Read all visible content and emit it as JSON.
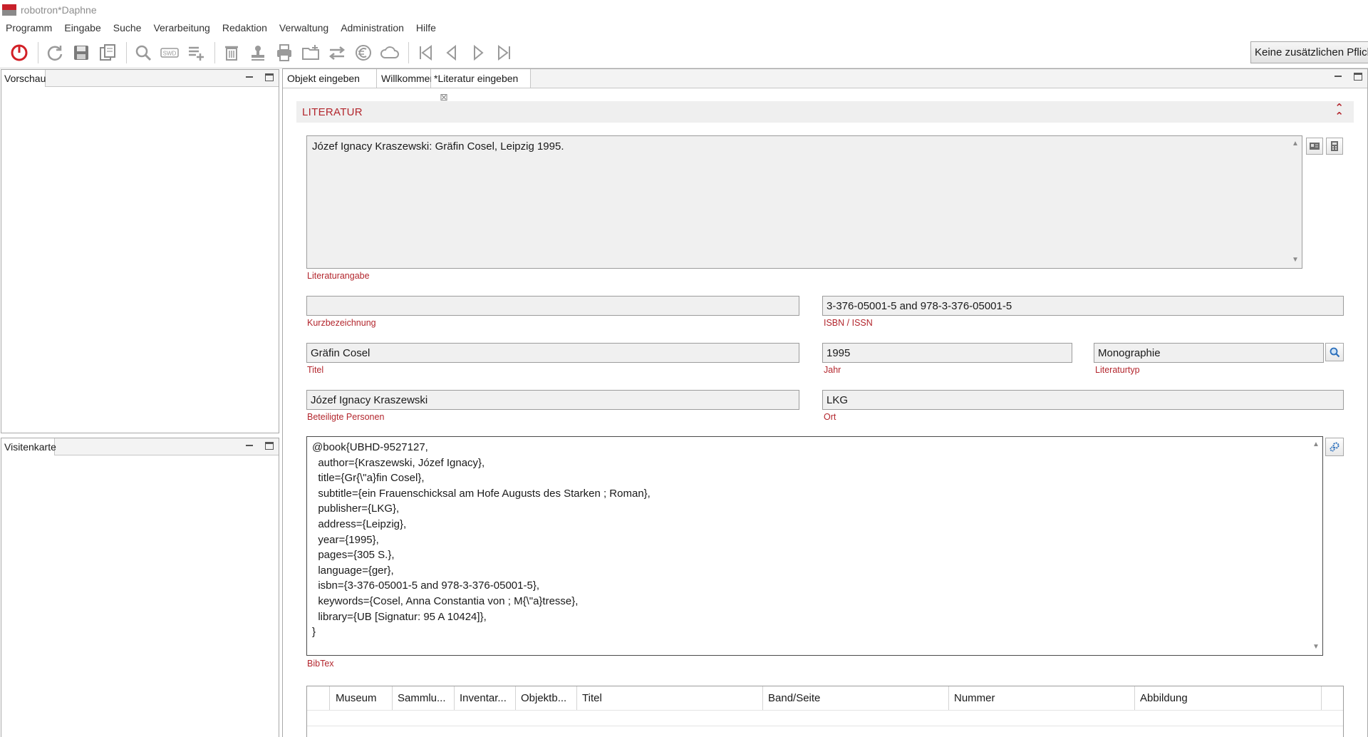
{
  "window": {
    "title": "robotron*Daphne"
  },
  "menubar": [
    "Programm",
    "Eingabe",
    "Suche",
    "Verarbeitung",
    "Redaktion",
    "Verwaltung",
    "Administration",
    "Hilfe"
  ],
  "toolbar": {
    "icons": [
      "power-icon",
      "refresh-icon",
      "save-icon",
      "copy-icon",
      "search-icon",
      "swd-icon",
      "add-list-icon",
      "delete-icon",
      "stamp-icon",
      "print-icon",
      "folder-add-icon",
      "transfer-icon",
      "euro-icon",
      "cloud-icon",
      "first-record-icon",
      "previous-record-icon",
      "next-record-icon",
      "last-record-icon"
    ],
    "swd_text": "SWD",
    "required_fields_button": "Keine zusätzlichen Pflichtfelder"
  },
  "panels": {
    "preview": {
      "tab": "Vorschau"
    },
    "card": {
      "tab": "Visitenkarte"
    }
  },
  "editor_tabs": [
    {
      "label": "Objekt eingeben"
    },
    {
      "label": "Willkommen"
    },
    {
      "label": "*Literatur eingeben"
    }
  ],
  "section": {
    "title": "LITERATUR",
    "collapse_symbol": "⌃"
  },
  "form": {
    "literaturangabe": {
      "value": "Józef Ignacy Kraszewski: Gräfin Cosel, Leipzig 1995.",
      "label": "Literaturangabe"
    },
    "kurzbezeichnung": {
      "value": "",
      "label": "Kurzbezeichnung"
    },
    "isbn": {
      "value": "3-376-05001-5 and 978-3-376-05001-5",
      "label": "ISBN / ISSN"
    },
    "titel": {
      "value": "Gräfin Cosel",
      "label": "Titel"
    },
    "jahr": {
      "value": "1995",
      "label": "Jahr"
    },
    "literaturtyp": {
      "value": "Monographie",
      "label": "Literaturtyp"
    },
    "personen": {
      "value": "Józef Ignacy Kraszewski",
      "label": "Beteiligte Personen"
    },
    "ort": {
      "value": "LKG",
      "label": "Ort"
    },
    "bibtex": {
      "label": "BibTex",
      "lines": [
        "@book{UBHD-9527127,",
        "  author={Kraszewski, Józef Ignacy},",
        "  title={Gr{\\\"a}fin Cosel},",
        "  subtitle={ein Frauenschicksal am Hofe Augusts des Starken ; Roman},",
        "  publisher={LKG},",
        "  address={Leipzig},",
        "  year={1995},",
        "  pages={305 S.},",
        "  language={ger},",
        "  isbn={3-376-05001-5 and 978-3-376-05001-5},",
        "  keywords={Cosel, Anna Constantia von ; M{\\\"a}tresse},",
        "  library={UB [Signatur: 95 A 10424]},",
        "}"
      ]
    }
  },
  "table": {
    "columns": [
      "Museum",
      "Sammlu...",
      "Inventar...",
      "Objektb...",
      "Titel",
      "Band/Seite",
      "Nummer",
      "Abbildung"
    ]
  }
}
